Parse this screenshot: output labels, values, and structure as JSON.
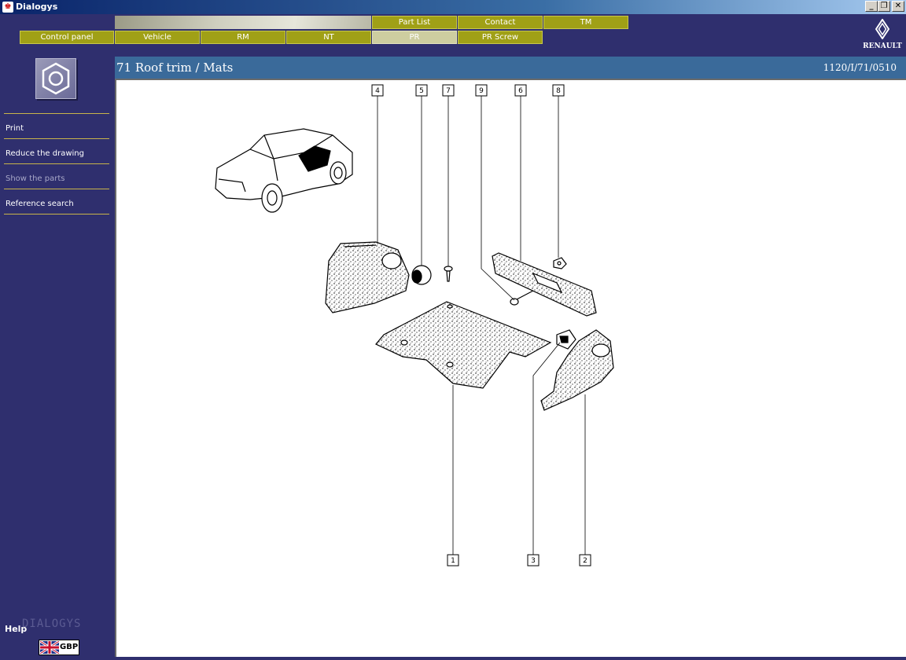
{
  "window": {
    "title": "Dialogys"
  },
  "nav": {
    "top_tabs": [
      "Part List",
      "Contact",
      "TM"
    ],
    "bottom_tabs": [
      "Control panel",
      "Vehicle",
      "RM",
      "NT",
      "PR",
      "PR Screw"
    ],
    "active_tab": "PR"
  },
  "brand": {
    "name": "RENAULT"
  },
  "sidebar": {
    "items": [
      {
        "label": "Print",
        "enabled": true
      },
      {
        "label": "Reduce the drawing",
        "enabled": true
      },
      {
        "label": "Show the parts",
        "enabled": false
      },
      {
        "label": "Reference search",
        "enabled": true
      }
    ],
    "help_label": "Help",
    "watermark": "DIALOGYS",
    "currency": "GBP"
  },
  "content": {
    "title": "71 Roof trim / Mats",
    "reference": "1120/I/71/0510",
    "callouts": [
      "4",
      "5",
      "7",
      "9",
      "6",
      "8",
      "1",
      "3",
      "2"
    ]
  },
  "colors": {
    "background": "#2f2f6e",
    "tab": "#a0a016",
    "tab_active": "#cdcda0",
    "content_header": "#3a6a9a",
    "separator": "#c8b44a"
  }
}
